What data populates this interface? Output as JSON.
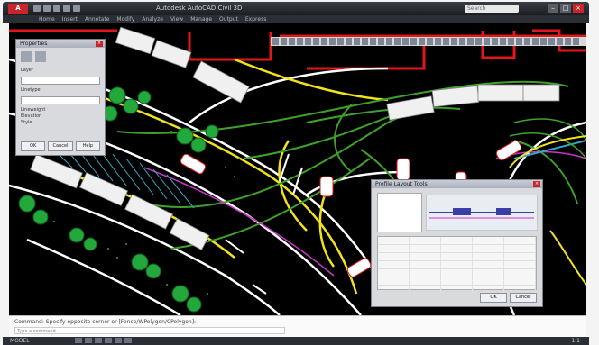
{
  "app": {
    "logo_text": "A",
    "title": "Autodesk AutoCAD Civil 3D",
    "search_placeholder": "Search",
    "window_controls": {
      "minimize": "–",
      "maximize": "□",
      "close": "×"
    }
  },
  "menubar": {
    "items": [
      "Home",
      "Insert",
      "Annotate",
      "Modify",
      "Analyze",
      "View",
      "Manage",
      "Output",
      "Express"
    ]
  },
  "dialog_left": {
    "title": "Properties",
    "rows": [
      "Layer",
      "Linetype",
      "Lineweight",
      "Elevation",
      "Style"
    ],
    "buttons": [
      "OK",
      "Cancel",
      "Help"
    ]
  },
  "dialog_right": {
    "title": "Profile Layout Tools",
    "buttons": [
      "OK",
      "Cancel"
    ]
  },
  "command": {
    "history": "Command: Specify opposite corner or [Fence/WPolygon/CPolygon]:",
    "placeholder": "Type a command"
  },
  "status": {
    "coords": "MODEL",
    "right": "1:1"
  },
  "colors": {
    "viewport_bg": "#000000",
    "road_white": "#ffffff",
    "road_yellow": "#f2e21a",
    "alignment_green": "#3fa02a",
    "boundary_red": "#e3161c",
    "hatch_cyan": "#34a8c9",
    "magenta": "#c637c7",
    "tree_green": "#23a83c"
  },
  "icons": {
    "app_logo": "autocad-logo-icon",
    "close": "close-icon",
    "tree": "tree-symbol-icon",
    "car": "car-icon"
  }
}
